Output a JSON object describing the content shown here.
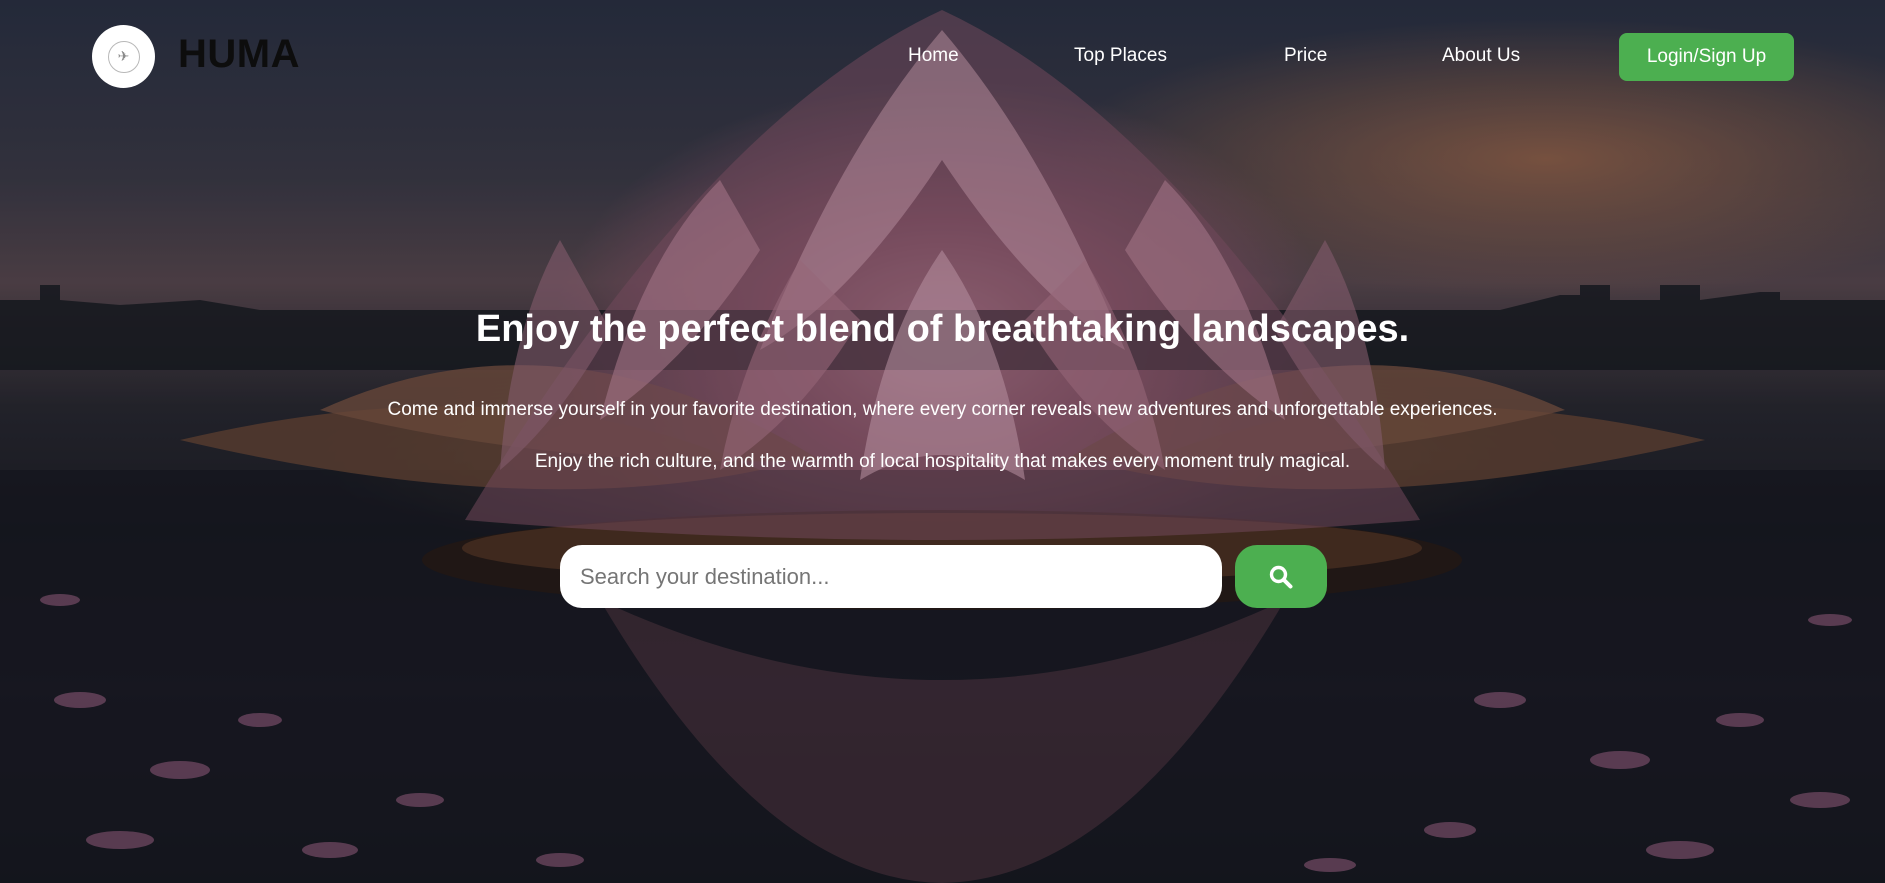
{
  "header": {
    "brand": "HUMA",
    "logo_icon": "plane-icon",
    "nav": [
      {
        "label": "Home"
      },
      {
        "label": "Top Places"
      },
      {
        "label": "Price"
      },
      {
        "label": "About Us"
      }
    ],
    "login_label": "Login/Sign Up"
  },
  "hero": {
    "title": "Enjoy the perfect blend of breathtaking landscapes.",
    "subtitle_1": "Come and immerse yourself in your favorite destination, where every corner reveals new adventures and unforgettable experiences.",
    "subtitle_2": "Enjoy the rich culture, and the warmth of local hospitality that makes every moment truly magical.",
    "background": "lotus-temple-at-dusk"
  },
  "search": {
    "value": "",
    "placeholder": "Search your destination...",
    "icon": "search-icon"
  },
  "colors": {
    "accent": "#4caf50",
    "text_light": "#ffffff",
    "brand_text": "#0d0d0d"
  }
}
